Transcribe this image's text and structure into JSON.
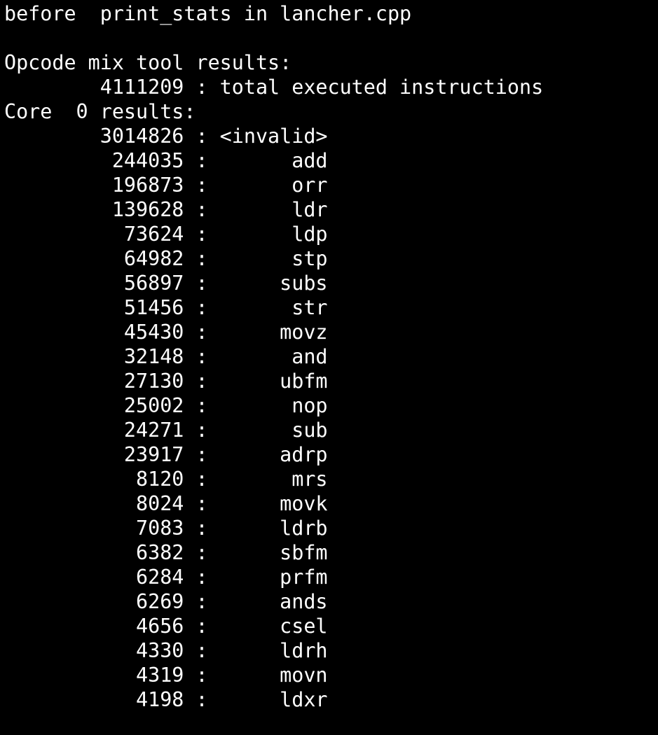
{
  "terminal": {
    "header_line": "before  print_stats in lancher.cpp",
    "tool_title": "Opcode mix tool results:",
    "total_line": "        4111209 : total executed instructions",
    "core_line": "Core  0 results:",
    "rows": [
      {
        "count": "3014826",
        "opcode": "<invalid>"
      },
      {
        "count": "244035",
        "opcode": "add"
      },
      {
        "count": "196873",
        "opcode": "orr"
      },
      {
        "count": "139628",
        "opcode": "ldr"
      },
      {
        "count": "73624",
        "opcode": "ldp"
      },
      {
        "count": "64982",
        "opcode": "stp"
      },
      {
        "count": "56897",
        "opcode": "subs"
      },
      {
        "count": "51456",
        "opcode": "str"
      },
      {
        "count": "45430",
        "opcode": "movz"
      },
      {
        "count": "32148",
        "opcode": "and"
      },
      {
        "count": "27130",
        "opcode": "ubfm"
      },
      {
        "count": "25002",
        "opcode": "nop"
      },
      {
        "count": "24271",
        "opcode": "sub"
      },
      {
        "count": "23917",
        "opcode": "adrp"
      },
      {
        "count": "8120",
        "opcode": "mrs"
      },
      {
        "count": "8024",
        "opcode": "movk"
      },
      {
        "count": "7083",
        "opcode": "ldrb"
      },
      {
        "count": "6382",
        "opcode": "sbfm"
      },
      {
        "count": "6284",
        "opcode": "prfm"
      },
      {
        "count": "6269",
        "opcode": "ands"
      },
      {
        "count": "4656",
        "opcode": "csel"
      },
      {
        "count": "4330",
        "opcode": "ldrh"
      },
      {
        "count": "4319",
        "opcode": "movn"
      },
      {
        "count": "4198",
        "opcode": "ldxr"
      }
    ]
  }
}
